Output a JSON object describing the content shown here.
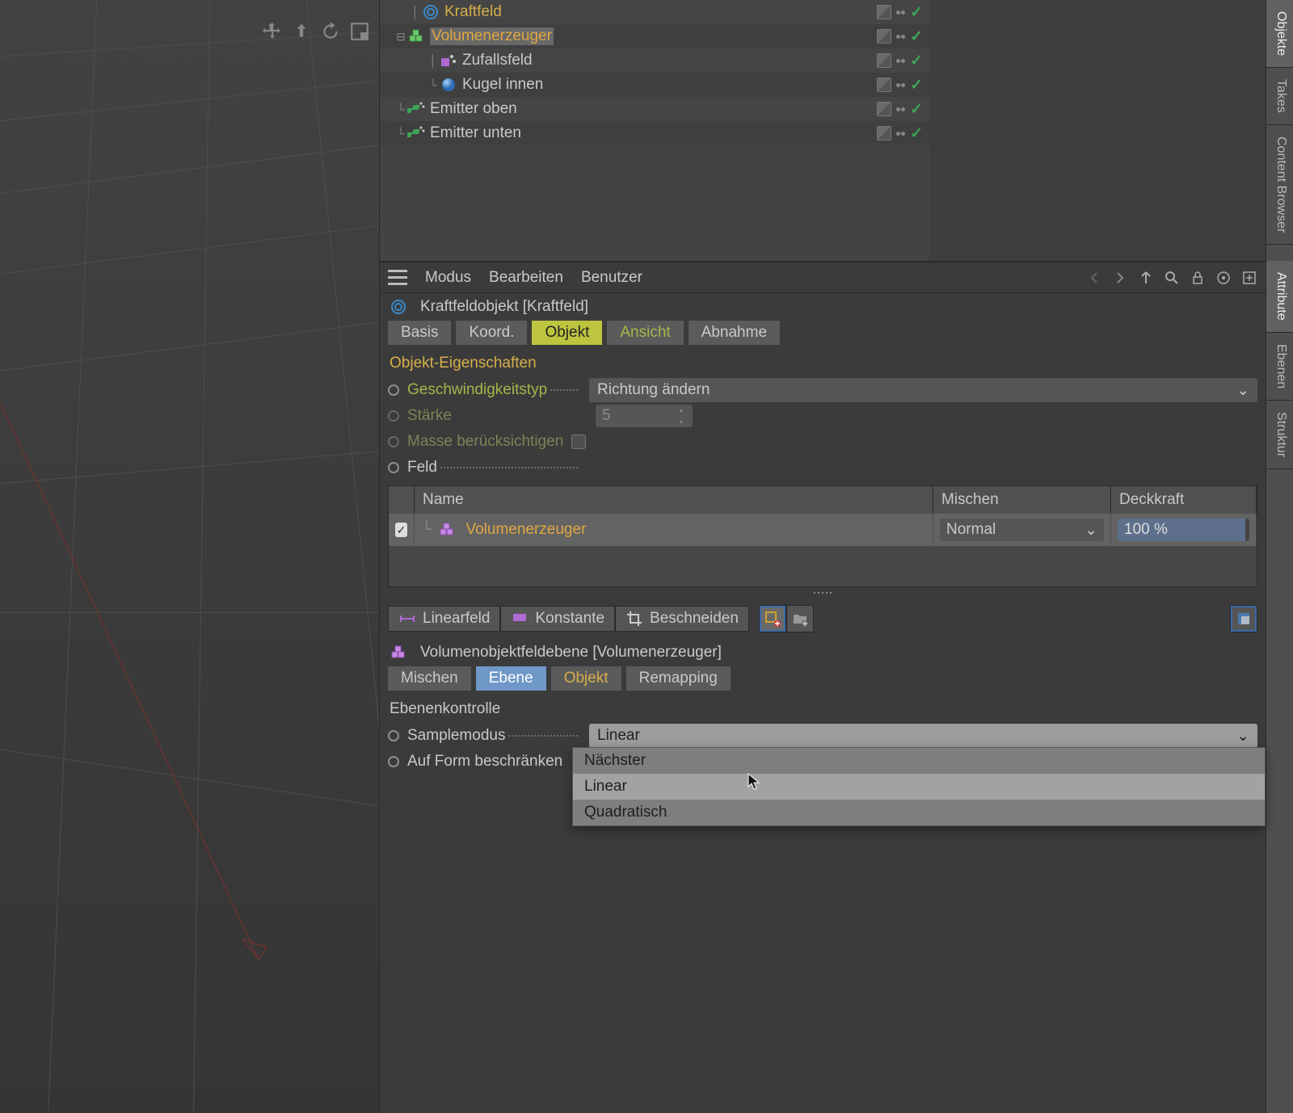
{
  "sideTabs": {
    "objects": "Objekte",
    "takes": "Takes",
    "content": "Content Browser",
    "attribute": "Attribute",
    "ebenen": "Ebenen",
    "struktur": "Struktur"
  },
  "objectManager": {
    "items": [
      {
        "name": "Kraftfeld",
        "icon": "kraftfeld",
        "indent": 0,
        "active": false,
        "sel": false
      },
      {
        "name": "Volumenerzeuger",
        "icon": "volume",
        "indent": 0,
        "active": true,
        "sel": true,
        "expander": "-"
      },
      {
        "name": "Zufallsfeld",
        "icon": "random",
        "indent": 1
      },
      {
        "name": "Kugel innen",
        "icon": "sphere",
        "indent": 1,
        "tag": "mat"
      },
      {
        "name": "Emitter oben",
        "icon": "emitter",
        "indent": 0
      },
      {
        "name": "Emitter unten",
        "icon": "emitter",
        "indent": 0
      }
    ]
  },
  "attributeManager": {
    "menus": {
      "mode": "Modus",
      "edit": "Bearbeiten",
      "user": "Benutzer"
    },
    "header": "Kraftfeldobjekt [Kraftfeld]",
    "tabs": {
      "basis": "Basis",
      "koord": "Koord.",
      "objekt": "Objekt",
      "ansicht": "Ansicht",
      "abnahme": "Abnahme"
    },
    "propsTitle": "Objekt-Eigenschaften",
    "speed": {
      "label": "Geschwindigkeitstyp",
      "value": "Richtung ändern"
    },
    "strength": {
      "label": "Stärke",
      "value": "5"
    },
    "mass": {
      "label": "Masse berücksichtigen"
    },
    "feld": {
      "label": "Feld"
    },
    "table": {
      "h_name": "Name",
      "h_mix": "Mischen",
      "h_opacity": "Deckkraft",
      "row": {
        "name": "Volumenerzeuger",
        "mix": "Normal",
        "opacity": "100 %"
      }
    },
    "fieldButtons": {
      "linear": "Linearfeld",
      "konstante": "Konstante",
      "beschneiden": "Beschneiden"
    }
  },
  "layerPanel": {
    "header": "Volumenobjektfeldebene [Volumenerzeuger]",
    "tabs": {
      "mischen": "Mischen",
      "ebene": "Ebene",
      "objekt": "Objekt",
      "remap": "Remapping"
    },
    "title": "Ebenenkontrolle",
    "sample": {
      "label": "Samplemodus",
      "value": "Linear"
    },
    "shape": {
      "label": "Auf Form beschränken"
    },
    "menu": {
      "naechster": "Nächster",
      "linear": "Linear",
      "quadratisch": "Quadratisch"
    }
  }
}
